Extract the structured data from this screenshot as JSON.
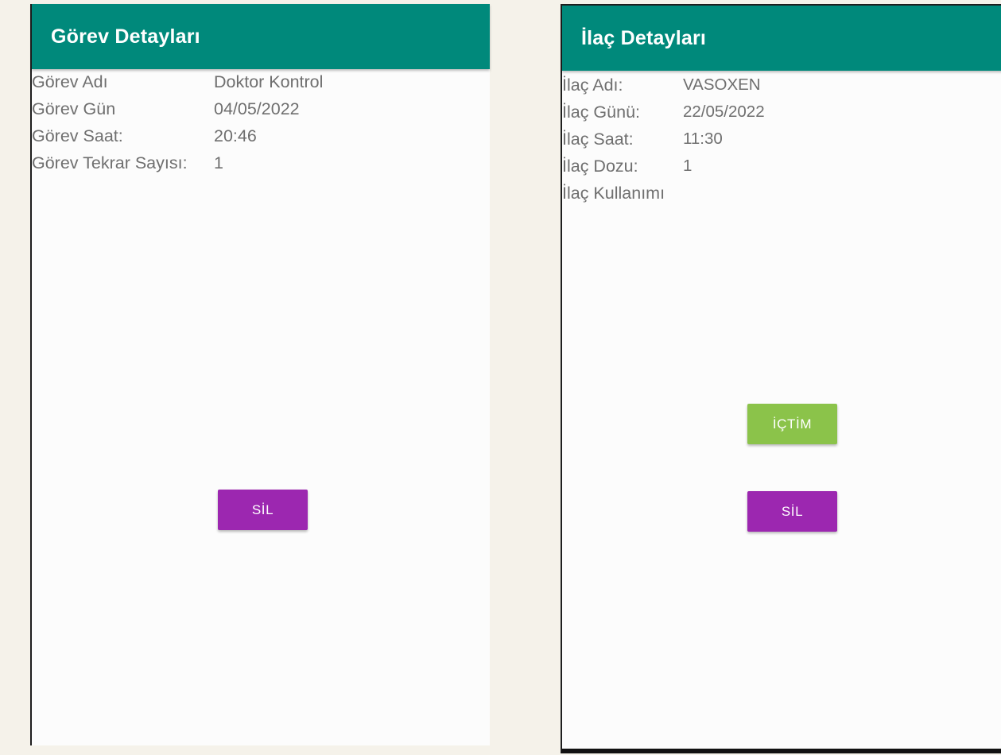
{
  "left_screen": {
    "title": "Görev Detayları",
    "rows": [
      {
        "label": "Görev Adı",
        "value": "Doktor Kontrol"
      },
      {
        "label": "Görev Gün",
        "value": "04/05/2022"
      },
      {
        "label": "Görev Saat:",
        "value": "20:46"
      },
      {
        "label": "Görev Tekrar Sayısı:",
        "value": "1"
      }
    ],
    "delete_label": "SİL"
  },
  "right_screen": {
    "title": "İlaç Detayları",
    "rows": [
      {
        "label": "İlaç Adı:",
        "value": "VASOXEN"
      },
      {
        "label": "İlaç Günü:",
        "value": "22/05/2022"
      },
      {
        "label": "İlaç Saat:",
        "value": "11:30"
      },
      {
        "label": "İlaç Dozu:",
        "value": "1"
      },
      {
        "label": "İlaç Kullanımı",
        "value": ""
      }
    ],
    "drank_label": "İÇTİM",
    "delete_label": "SİL"
  },
  "colors": {
    "appbar": "#00897b",
    "delete_button": "#9c27b0",
    "drank_button": "#8bc34a"
  }
}
